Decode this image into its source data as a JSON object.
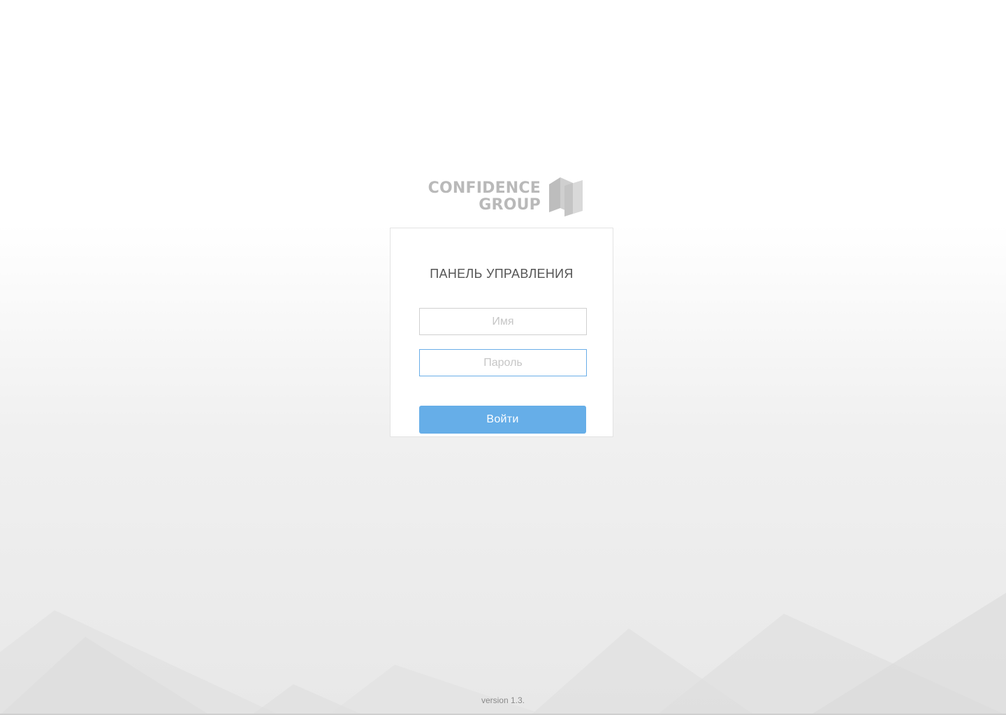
{
  "logo": {
    "line1": "CONFIDENCE",
    "line2": "GROUP",
    "mark_icon": "confidence-group-cube-icon"
  },
  "login": {
    "title": "ПАНЕЛЬ УПРАВЛЕНИЯ",
    "username_placeholder": "Имя",
    "username_value": "",
    "password_placeholder": "Пароль",
    "password_value": "",
    "submit_label": "Войти"
  },
  "footer": {
    "version": "version 1.3."
  },
  "colors": {
    "accent": "#66aee8",
    "focus_border": "#6aaee8",
    "logo_gray": "#b9b9b9",
    "title_text": "#555555"
  }
}
